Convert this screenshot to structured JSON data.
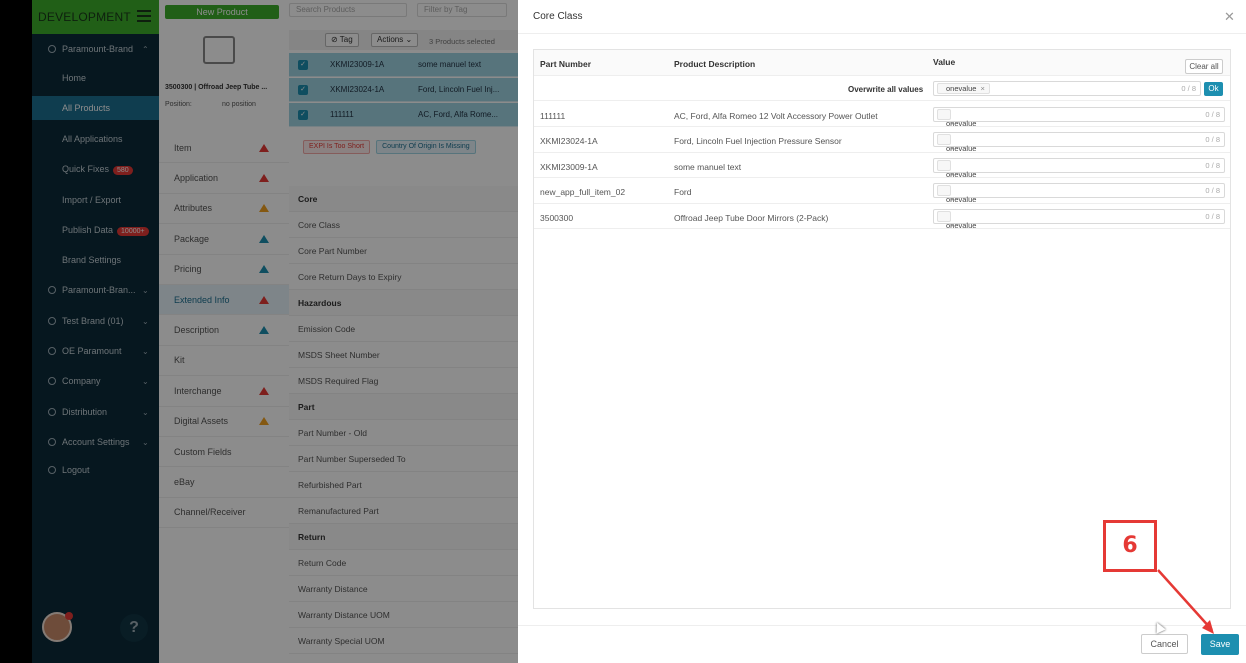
{
  "sidebar": {
    "env": "DEVELOPMENT",
    "brand_open": "Paramount-Brand",
    "sub_items": [
      {
        "label": "Home"
      },
      {
        "label": "All Products"
      },
      {
        "label": "All Applications"
      },
      {
        "label": "Quick Fixes",
        "badge": "580"
      },
      {
        "label": "Import / Export"
      },
      {
        "label": "Publish Data",
        "badge": "10000+"
      },
      {
        "label": "Brand Settings"
      }
    ],
    "groups": [
      {
        "label": "Paramount-Bran..."
      },
      {
        "label": "Test Brand (01)"
      },
      {
        "label": "OE Paramount"
      },
      {
        "label": "Company"
      },
      {
        "label": "Distribution"
      },
      {
        "label": "Account Settings"
      },
      {
        "label": "Logout"
      }
    ]
  },
  "product_panel": {
    "new_product": "New Product",
    "title": "3500300 | Offroad Jeep Tube ...",
    "position_label": "Position:",
    "position_value": "no position"
  },
  "tabs": [
    {
      "label": "Item",
      "warn": "red"
    },
    {
      "label": "Application",
      "warn": "red"
    },
    {
      "label": "Attributes",
      "warn": "orange"
    },
    {
      "label": "Package",
      "warn": "blue"
    },
    {
      "label": "Pricing",
      "warn": "blue"
    },
    {
      "label": "Extended Info",
      "warn": "red"
    },
    {
      "label": "Description",
      "warn": "blue"
    },
    {
      "label": "Kit",
      "warn": ""
    },
    {
      "label": "Interchange",
      "warn": "red"
    },
    {
      "label": "Digital Assets",
      "warn": "orange"
    },
    {
      "label": "Custom Fields",
      "warn": ""
    },
    {
      "label": "eBay",
      "warn": ""
    },
    {
      "label": "Channel/Receiver",
      "warn": ""
    }
  ],
  "main": {
    "search_placeholder": "Search Products",
    "filter_placeholder": "Filter by Tag",
    "tag_label": "Tag",
    "actions_label": "Actions",
    "selected_text": "3 Products selected",
    "rows": [
      {
        "part": "XKMI23009-1A",
        "desc": "some manuel text"
      },
      {
        "part": "XKMI23024-1A",
        "desc": "Ford, Lincoln Fuel Inj..."
      },
      {
        "part": "111111",
        "desc": "AC, Ford, Alfa Rome..."
      }
    ],
    "filter_tags": [
      "EXPI Is Too Short",
      "Country Of Origin Is Missing"
    ],
    "fields": [
      {
        "label": "Core",
        "head": true
      },
      {
        "label": "Core Class"
      },
      {
        "label": "Core Part Number"
      },
      {
        "label": "Core Return Days to Expiry"
      },
      {
        "label": "Hazardous",
        "head": true
      },
      {
        "label": "Emission Code"
      },
      {
        "label": "MSDS Sheet Number"
      },
      {
        "label": "MSDS Required Flag"
      },
      {
        "label": "Part",
        "head": true
      },
      {
        "label": "Part Number - Old"
      },
      {
        "label": "Part Number Superseded To"
      },
      {
        "label": "Refurbished Part"
      },
      {
        "label": "Remanufactured Part"
      },
      {
        "label": "Return",
        "head": true
      },
      {
        "label": "Return Code"
      },
      {
        "label": "Warranty Distance"
      },
      {
        "label": "Warranty Distance UOM"
      },
      {
        "label": "Warranty Special UOM"
      }
    ]
  },
  "drawer": {
    "title": "Core Class",
    "columns": {
      "part": "Part Number",
      "desc": "Product Description",
      "value": "Value"
    },
    "clear_all": "Clear all",
    "overwrite_label": "Overwrite all values",
    "overwrite_tag": "onevalue",
    "overwrite_count": "0 / 8",
    "ok": "Ok",
    "rows": [
      {
        "part": "111111",
        "desc": "AC, Ford, Alfa Romeo 12 Volt Accessory Power Outlet",
        "tag": "onevalue",
        "count": "0 / 8"
      },
      {
        "part": "XKMI23024-1A",
        "desc": "Ford, Lincoln Fuel Injection Pressure Sensor",
        "tag": "onevalue",
        "count": "0 / 8"
      },
      {
        "part": "XKMI23009-1A",
        "desc": "some manuel text",
        "tag": "onevalue",
        "count": "0 / 8"
      },
      {
        "part": "new_app_full_item_02",
        "desc": "Ford",
        "tag": "onevalue",
        "count": "0 / 8"
      },
      {
        "part": "3500300",
        "desc": "Offroad Jeep Tube Door Mirrors (2-Pack)",
        "tag": "onevalue",
        "count": "0 / 8"
      }
    ],
    "cancel": "Cancel",
    "save": "Save"
  },
  "annotation": {
    "step": "6",
    "color": "#e53935"
  }
}
